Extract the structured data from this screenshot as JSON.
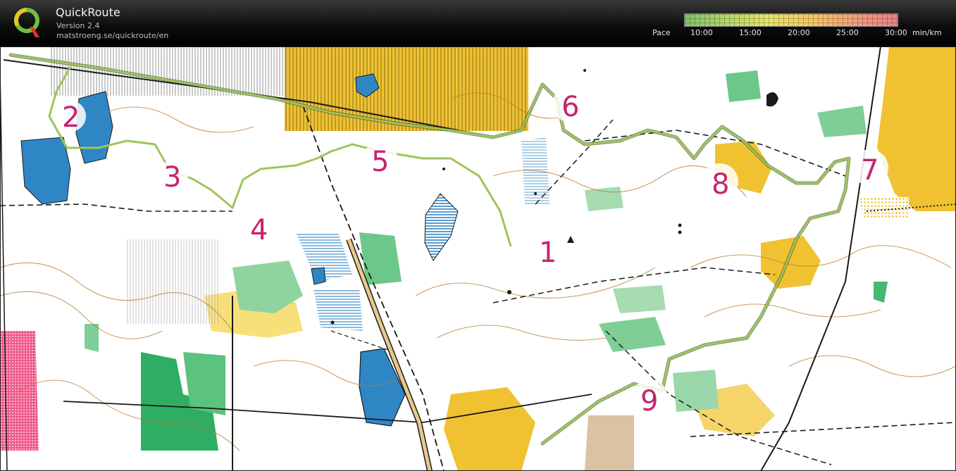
{
  "app": {
    "title": "QuickRoute",
    "version": "Version 2.4",
    "url": "matstroeng.se/quickroute/en"
  },
  "pace_scale": {
    "label": "Pace",
    "ticks": [
      "10:00",
      "15:00",
      "20:00",
      "25:00",
      "30:00"
    ],
    "unit": "min/km",
    "colors": [
      "#7dc36b",
      "#b7d76a",
      "#e8e66a",
      "#f6c763",
      "#f3a07c",
      "#ef7f86"
    ]
  },
  "map": {
    "controls": [
      "1",
      "2",
      "3",
      "4",
      "5",
      "6",
      "7",
      "8",
      "9"
    ],
    "route_color": "#6f8f3a",
    "water_color": "#2f86c5",
    "control_color": "#c6246e",
    "open_land_color": "#f0c232"
  }
}
